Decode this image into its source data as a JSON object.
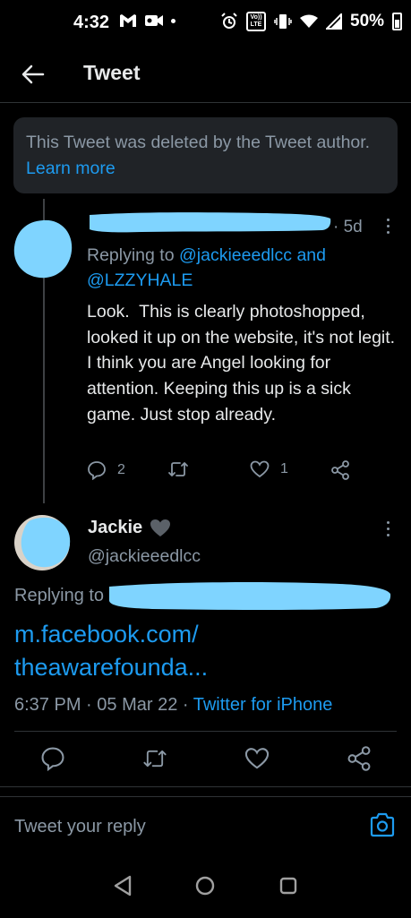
{
  "status_bar": {
    "time": "4:32",
    "volte_label": "Vo)) LTE",
    "battery_text": "50%"
  },
  "header": {
    "title": "Tweet"
  },
  "deleted_notice": {
    "text": "This Tweet was deleted by the Tweet author.",
    "link_label": "Learn more"
  },
  "reply_tweet": {
    "time_ago": "· 5d",
    "replying_prefix": "Replying to",
    "reply_handle_1": "@jackieeedlcc",
    "reply_and": "and",
    "reply_handle_2": "@LZZYHALE",
    "body": "Look.  This is clearly photoshopped, looked it up on the website, it's not legit.  I think you are Angel looking for attention. Keeping this up is a sick game. Just stop already.",
    "reply_count": "2",
    "retweet_count": "",
    "like_count": "1"
  },
  "main_tweet": {
    "author_name": "Jackie",
    "author_handle": "@jackieeedlcc",
    "replying_prefix": "Replying to",
    "link_text": "m.facebook.com/ theawarefounda...",
    "time": "6:37 PM",
    "date": "05 Mar 22",
    "source": "Twitter for iPhone"
  },
  "composer": {
    "placeholder": "Tweet your reply"
  },
  "colors": {
    "background": "#000000",
    "accent": "#1d9bf0",
    "muted": "#8b98a5",
    "redaction": "#7fd4ff"
  }
}
